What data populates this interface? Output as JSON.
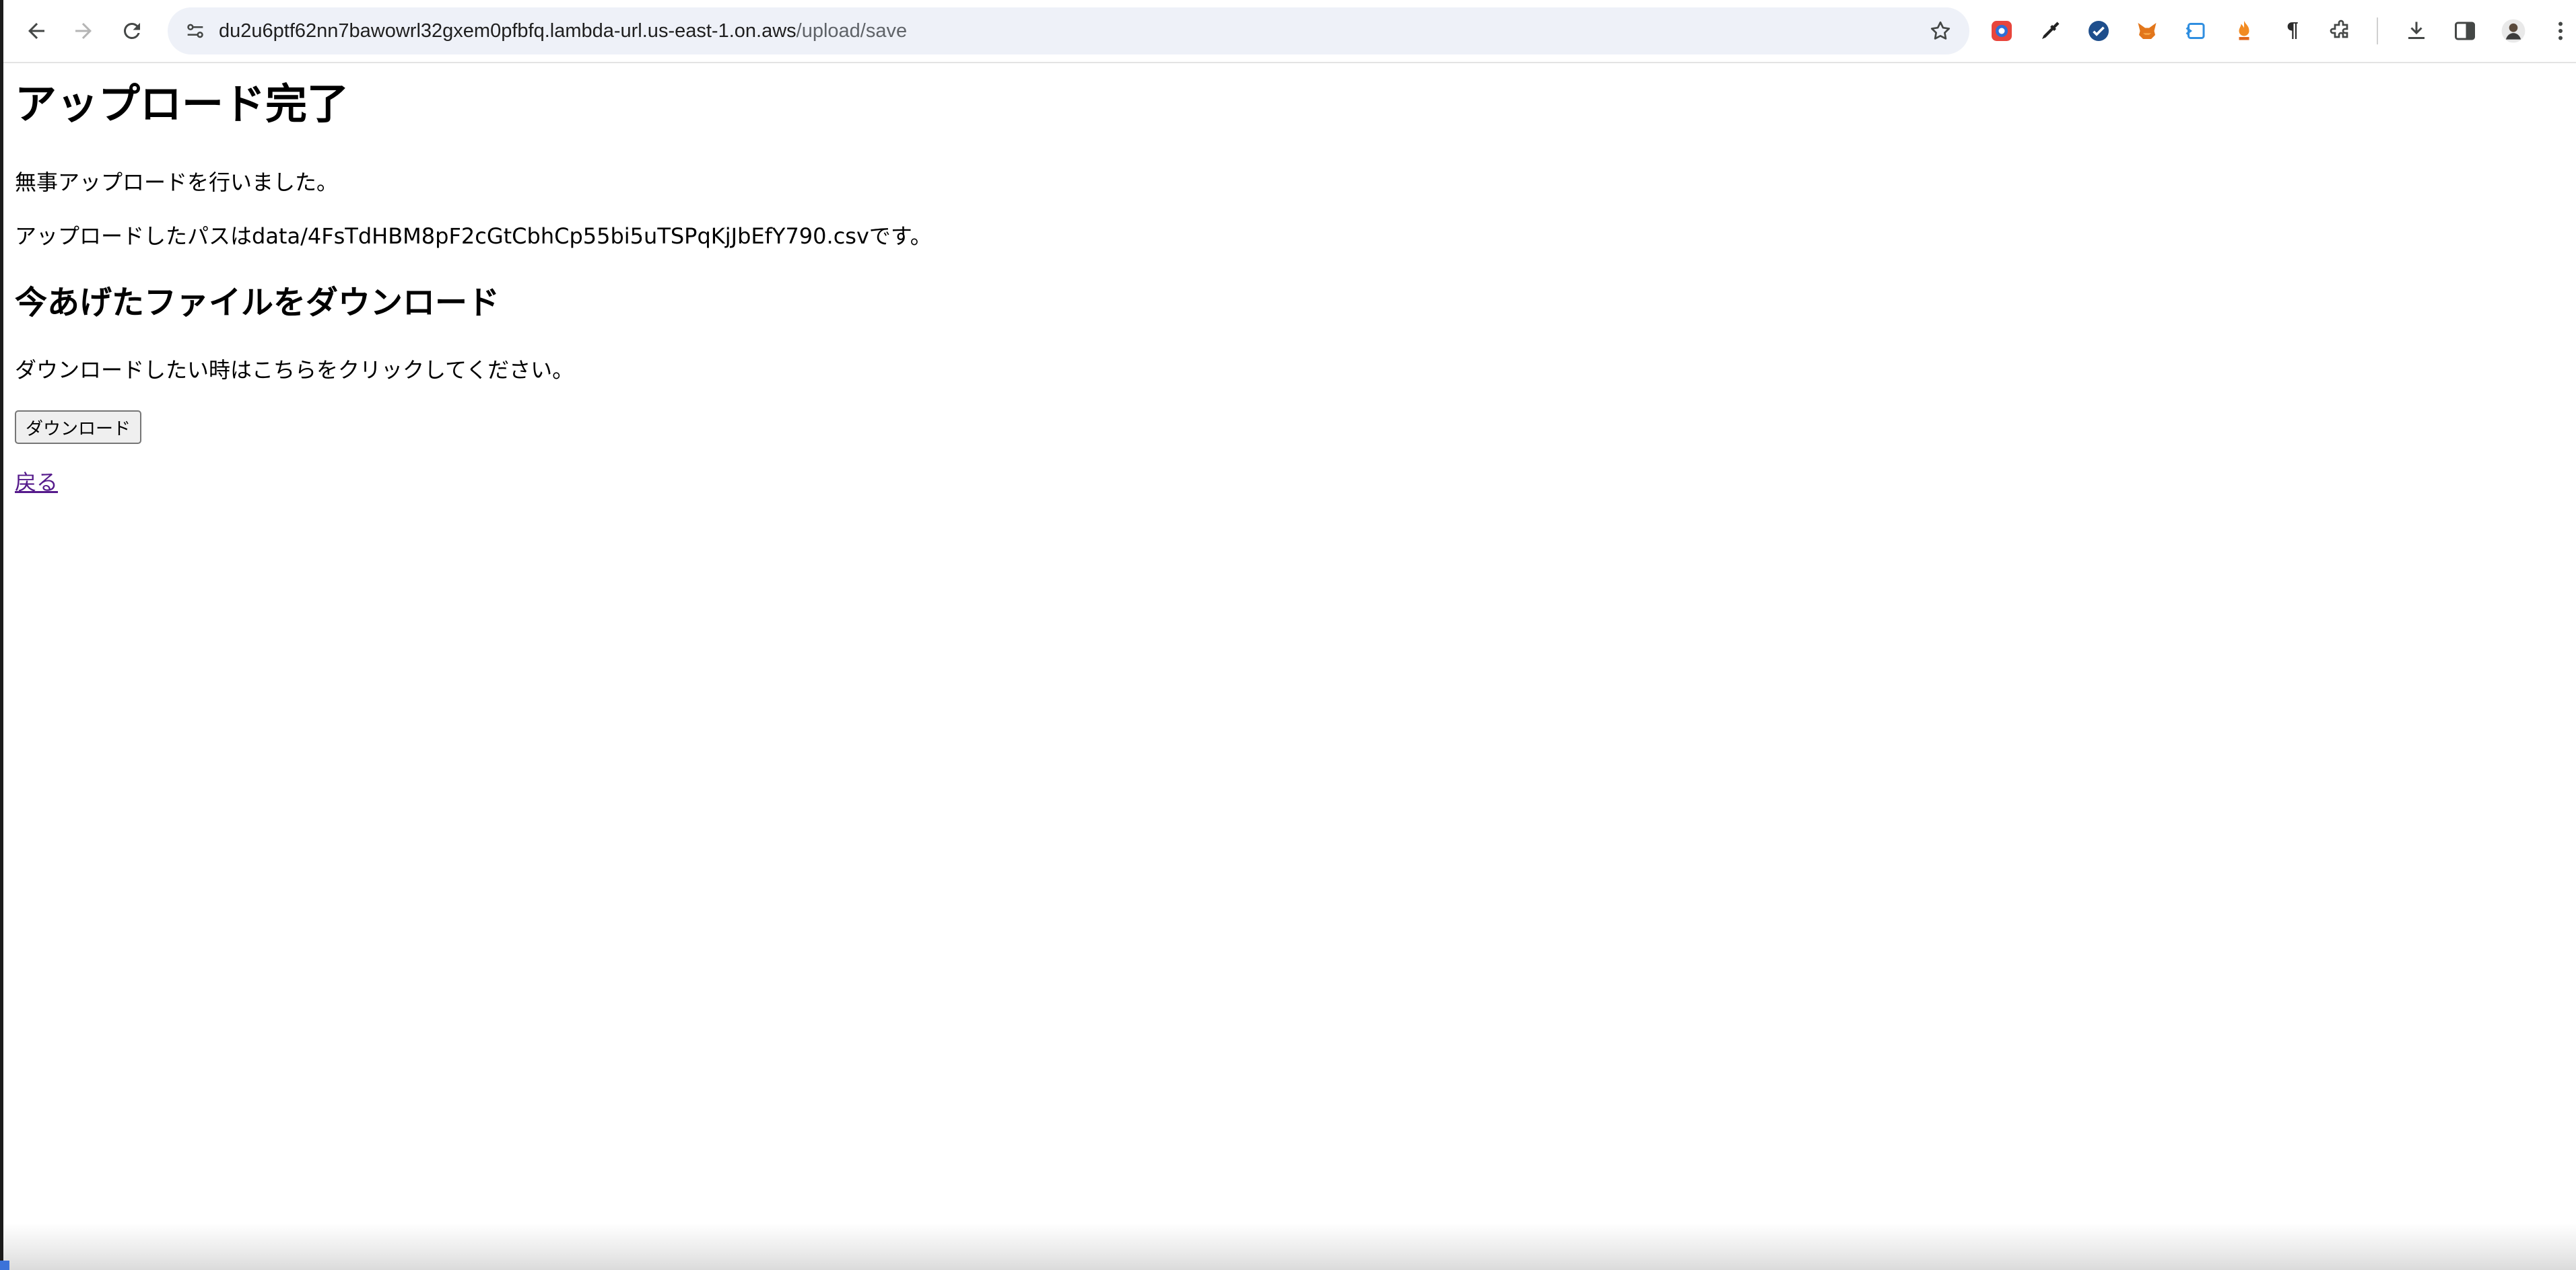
{
  "browser": {
    "url_host": "du2u6ptf62nn7bawowrl32gxem0pfbfq.lambda-url.us-east-1.on.aws",
    "url_path": "/upload/save",
    "icons": {
      "back": "back-arrow-icon",
      "forward": "forward-arrow-icon",
      "reload": "reload-icon",
      "site_info": "site-settings-icon",
      "bookmark": "star-icon",
      "downloads": "download-icon",
      "side_panel": "side-panel-icon",
      "menu": "kebab-menu-icon"
    },
    "extensions": [
      {
        "name": "color-picker-extension-icon",
        "glyph": "◉",
        "color": "#d6452c"
      },
      {
        "name": "eyedropper-extension-icon",
        "glyph": "✒",
        "color": "#222222"
      },
      {
        "name": "check-extension-icon",
        "glyph": "✔",
        "color": "#ffffff"
      },
      {
        "name": "metamask-fox-icon",
        "glyph": "🦊",
        "color": "#e2761b"
      },
      {
        "name": "tag-extension-icon",
        "glyph": "⧉",
        "color": "#2f8ee0"
      },
      {
        "name": "flame-extension-icon",
        "glyph": "♨",
        "color": "#f28b22"
      },
      {
        "name": "pilcrow-extension-icon",
        "glyph": "¶",
        "color": "#2b2b2b"
      },
      {
        "name": "puzzle-extensions-icon",
        "glyph": "⧠",
        "color": "#444746"
      }
    ]
  },
  "page": {
    "title": "アップロード完了",
    "success_message": "無事アップロードを行いました。",
    "path_message": "アップロードしたパスはdata/4FsTdHBM8pF2cGtCbhCp55bi5uTSPqKjJbEfY790.csvです。",
    "download_heading": "今あげたファイルをダウンロード",
    "download_instruction": "ダウンロードしたい時はこちらをクリックしてください。",
    "download_button_label": "ダウンロード",
    "back_link_label": "戻る"
  },
  "colors": {
    "link_visited": "#551a8b",
    "omnibox_bg": "#eef1f8"
  }
}
